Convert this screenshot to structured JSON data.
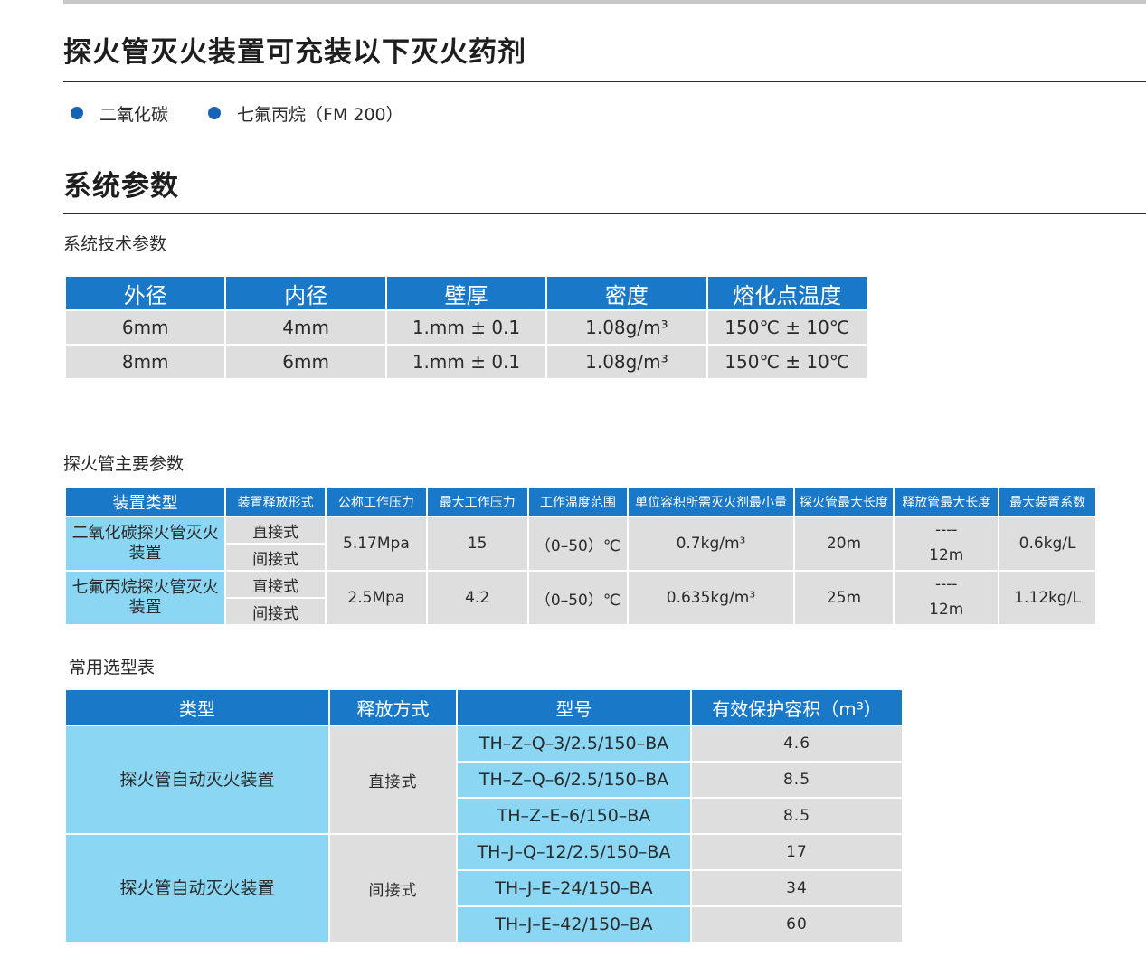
{
  "headings": {
    "agents_title": "探火管灭火装置可充装以下灭火药剂",
    "params_title": "系统参数"
  },
  "agents": [
    "二氧化碳",
    "七氟丙烷（FM 200）"
  ],
  "tech_params": {
    "subtitle": "系统技术参数",
    "headers": [
      "外径",
      "内径",
      "壁厚",
      "密度",
      "熔化点温度"
    ],
    "rows": [
      [
        "6mm",
        "4mm",
        "1.mm ± 0.1",
        "1.08g/m³",
        "150℃ ± 10℃"
      ],
      [
        "8mm",
        "6mm",
        "1.mm ± 0.1",
        "1.08g/m³",
        "150℃ ± 10℃"
      ]
    ]
  },
  "main_params": {
    "subtitle": "探火管主要参数",
    "headers": [
      "装置类型",
      "装置释放形式",
      "公称工作压力",
      "最大工作压力",
      "工作温度范围",
      "单位容积所需灭火剂最小量",
      "探火管最大长度",
      "释放管最大长度",
      "最大装置系数"
    ],
    "groups": [
      {
        "type": "二氧化碳探火管灭火装置",
        "modes": [
          "直接式",
          "间接式"
        ],
        "nominal_pressure": "5.17Mpa",
        "max_pressure": "15",
        "temp_range": "（0–50）℃",
        "min_agent": "0.7kg/m³",
        "detector_len": "20m",
        "release_dash": "----",
        "release_len": "12m",
        "factor": "0.6kg/L"
      },
      {
        "type": "七氟丙烷探火管灭火装置",
        "modes": [
          "直接式",
          "间接式"
        ],
        "nominal_pressure": "2.5Mpa",
        "max_pressure": "4.2",
        "temp_range": "（0–50）℃",
        "min_agent": "0.635kg/m³",
        "detector_len": "25m",
        "release_dash": "----",
        "release_len": "12m",
        "factor": "1.12kg/L"
      }
    ]
  },
  "selection": {
    "subtitle": "常用选型表",
    "headers": [
      "类型",
      "释放方式",
      "型号",
      "有效保护容积（m³）"
    ],
    "groups": [
      {
        "type": "探火管自动灭火装置",
        "mode": "直接式",
        "rows": [
          {
            "model": "TH–Z–Q–3/2.5/150–BA",
            "volume": "4.6"
          },
          {
            "model": "TH–Z–Q–6/2.5/150–BA",
            "volume": "8.5"
          },
          {
            "model": "TH–Z–E–6/150–BA",
            "volume": "8.5"
          }
        ]
      },
      {
        "type": "探火管自动灭火装置",
        "mode": "间接式",
        "rows": [
          {
            "model": "TH–J–Q–12/2.5/150–BA",
            "volume": "17"
          },
          {
            "model": "TH–J–E–24/150–BA",
            "volume": "34"
          },
          {
            "model": "TH–J–E–42/150–BA",
            "volume": "60"
          }
        ]
      }
    ]
  },
  "colors": {
    "header_blue": "#1a78c9",
    "label_cyan": "#8ad6f3",
    "cell_gray": "#dedede",
    "bullet_blue": "#1764b6"
  }
}
